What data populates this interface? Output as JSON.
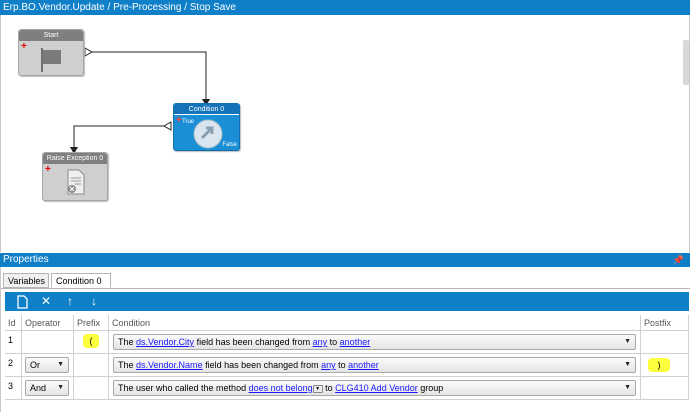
{
  "window": {
    "title": "Erp.BO.Vendor.Update / Pre-Processing / Stop Save"
  },
  "workflow": {
    "start": {
      "title": "Start"
    },
    "condition": {
      "title": "Condition 0",
      "true_label": "True",
      "false_label": "False"
    },
    "raise": {
      "title": "Raise Exception 0"
    }
  },
  "properties": {
    "title": "Properties",
    "pin_icon": "pin-icon",
    "tabs": [
      {
        "label": "Variables"
      },
      {
        "label": "Condition 0",
        "active": true
      }
    ],
    "toolbar": [
      "new-icon",
      "delete-icon",
      "move-up-icon",
      "move-down-icon"
    ],
    "grid": {
      "headers": {
        "id": "Id",
        "operator": "Operator",
        "prefix": "Prefix",
        "condition": "Condition",
        "postfix": "Postfix"
      },
      "rows": [
        {
          "id": "1",
          "operator": "",
          "prefix": "(",
          "postfix": "",
          "condition": {
            "pre": "The ",
            "link1": "ds.Vendor.City",
            "mid1": " field has been changed from ",
            "link2": "any",
            "mid2": " to ",
            "link3": "another"
          }
        },
        {
          "id": "2",
          "operator": "Or",
          "prefix": "",
          "postfix": ")",
          "condition": {
            "pre": "The ",
            "link1": "ds.Vendor.Name",
            "mid1": " field has been changed from ",
            "link2": "any",
            "mid2": " to ",
            "link3": "another"
          }
        },
        {
          "id": "3",
          "operator": "And",
          "prefix": "",
          "postfix": "",
          "condition": {
            "pre": "The user who called the method ",
            "link1": "does not belong",
            "mid1": " to ",
            "link2": "CLG410 Add Vendor",
            "mid2": " group"
          }
        }
      ]
    }
  },
  "colors": {
    "accent": "#0f7fc7",
    "highlight": "#fbff3d",
    "link": "#1a1aff"
  }
}
